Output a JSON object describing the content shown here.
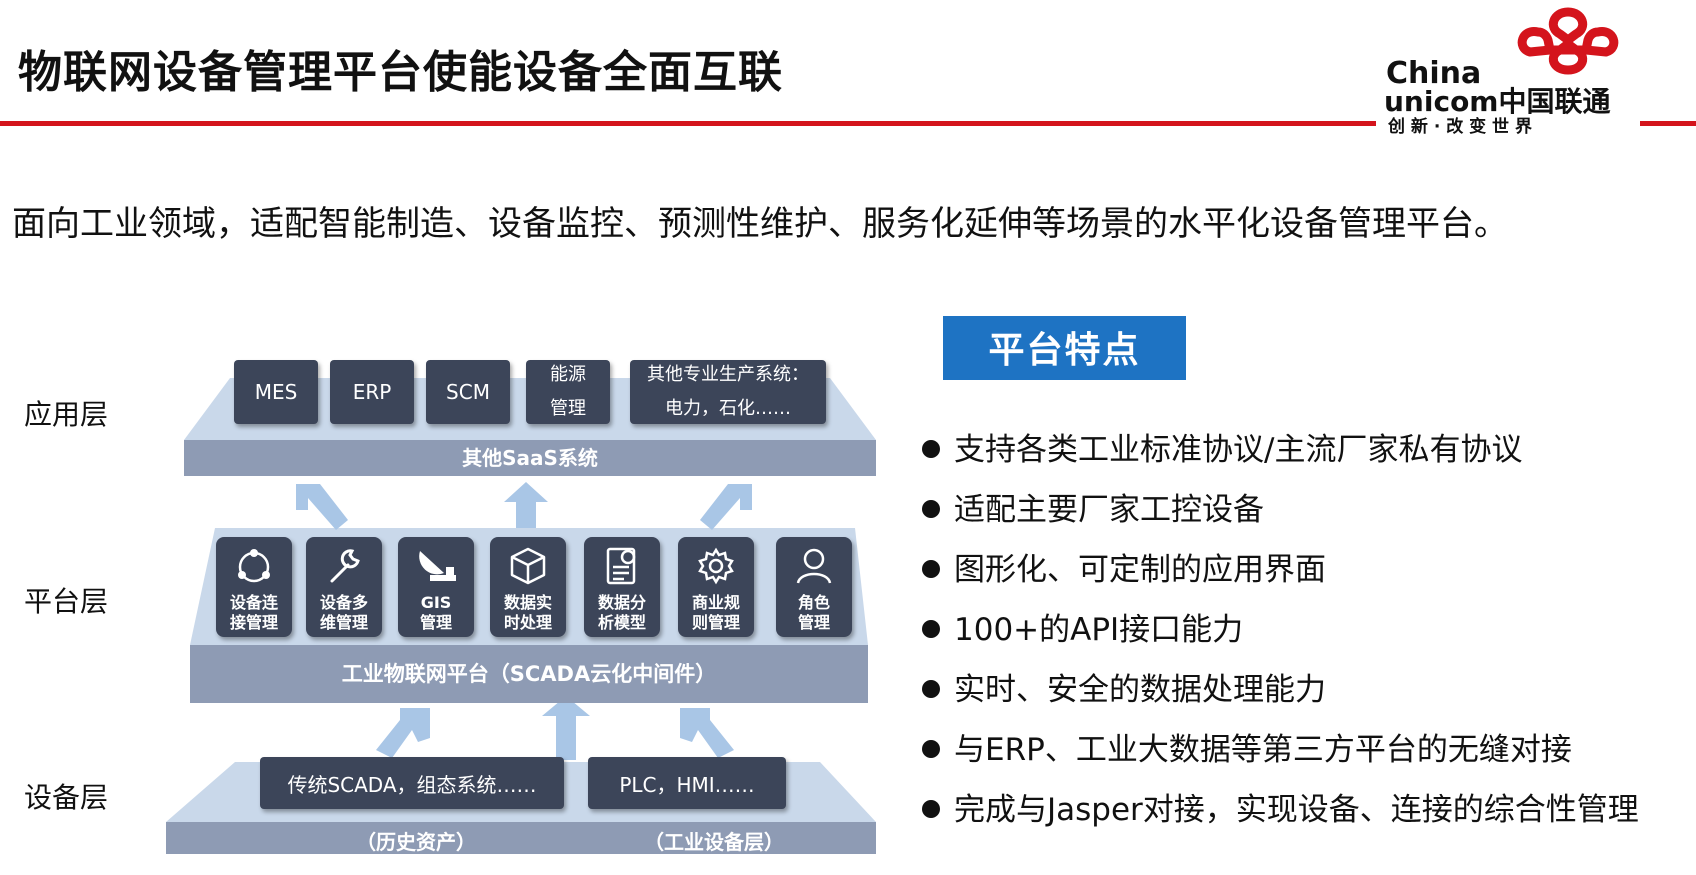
{
  "header": {
    "title": "物联网设备管理平台使能设备全面互联",
    "logo": {
      "line1": "China",
      "line2": "unicom中国联通",
      "slogan": "创 新 · 改 变 世 界"
    },
    "brand_color": "#d4141c"
  },
  "subtitle": "面向工业领域，适配智能制造、设备监控、预测性维护、服务化延伸等场景的水平化设备管理平台。",
  "diagram": {
    "layers": [
      "应用层",
      "平台层",
      "设备层"
    ],
    "app_boxes": [
      "MES",
      "ERP",
      "SCM",
      "能源\n管理",
      "其他专业生产系统：\n电力，石化……"
    ],
    "app_bar": "其他SaaS系统",
    "platform_modules": [
      {
        "label": "设备连\n接管理",
        "icon": "connection-icon"
      },
      {
        "label": "设备多\n维管理",
        "icon": "wrench-icon"
      },
      {
        "label": "GIS\n管理",
        "icon": "satellite-dish-icon"
      },
      {
        "label": "数据实\n时处理",
        "icon": "data-cube-icon"
      },
      {
        "label": "数据分\n析模型",
        "icon": "document-chart-icon"
      },
      {
        "label": "商业规\n则管理",
        "icon": "gear-icon"
      },
      {
        "label": "角色\n管理",
        "icon": "user-icon"
      }
    ],
    "platform_bar": "工业物联网平台（SCADA云化中间件）",
    "device_boxes": [
      "传统SCADA，组态系统……",
      "PLC，HMI……"
    ],
    "device_bar_left": "（历史资产）",
    "device_bar_right": "（工业设备层）"
  },
  "features": {
    "heading": "平台特点",
    "items": [
      "支持各类工业标准协议/主流厂家私有协议",
      "适配主要厂家工控设备",
      "图形化、可定制的应用界面",
      "100+的API接口能力",
      "实时、安全的数据处理能力",
      "与ERP、工业大数据等第三方平台的无缝对接",
      "完成与Jasper对接，实现设备、连接的综合性管理"
    ]
  }
}
